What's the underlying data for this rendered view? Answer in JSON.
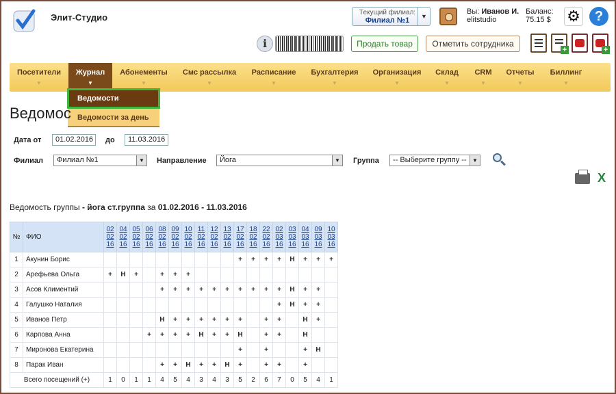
{
  "app": {
    "brand": "Элит-Студио",
    "branch_caption": "Текущий филиал:",
    "branch_value": "Филиал №1",
    "user_prefix": "Вы:",
    "user_name": "Иванов И.",
    "user_login": "elitstudio",
    "balance_caption": "Баланс:",
    "balance_value": "75.15 $"
  },
  "toolbar": {
    "sell_label": "Продать товар",
    "mark_employee_label": "Отметить сотрудника"
  },
  "menu": [
    {
      "label": "Посетители"
    },
    {
      "label": "Журнал"
    },
    {
      "label": "Абонементы"
    },
    {
      "label": "Смс рассылка"
    },
    {
      "label": "Расписание"
    },
    {
      "label": "Бухгалтерия"
    },
    {
      "label": "Организация"
    },
    {
      "label": "Склад"
    },
    {
      "label": "CRM"
    },
    {
      "label": "Отчеты"
    },
    {
      "label": "Биллинг"
    }
  ],
  "dropdown": [
    "Ведомости",
    "Ведомости за день"
  ],
  "page": {
    "title": "Ведомос"
  },
  "filters": {
    "date_from_label": "Дата от",
    "date_from": "01.02.2016",
    "date_to_label": "до",
    "date_to": "11.03.2016",
    "branch_label": "Филиал",
    "branch": "Филиал №1",
    "direction_label": "Направление",
    "direction": "Йога",
    "group_label": "Группа",
    "group": "-- Выберите группу --"
  },
  "report": {
    "prefix": "Ведомость группы",
    "group": " - йога ст.группа",
    "mid": " за ",
    "period": "01.02.2016 - 11.03.2016"
  },
  "table": {
    "col_no": "№",
    "col_fio": "ФИО",
    "dates": [
      [
        "02",
        "02",
        "16"
      ],
      [
        "04",
        "02",
        "16"
      ],
      [
        "05",
        "02",
        "16"
      ],
      [
        "06",
        "02",
        "16"
      ],
      [
        "08",
        "02",
        "16"
      ],
      [
        "09",
        "02",
        "16"
      ],
      [
        "10",
        "02",
        "16"
      ],
      [
        "11",
        "02",
        "16"
      ],
      [
        "12",
        "02",
        "16"
      ],
      [
        "13",
        "02",
        "16"
      ],
      [
        "17",
        "02",
        "16"
      ],
      [
        "18",
        "02",
        "16"
      ],
      [
        "22",
        "02",
        "16"
      ],
      [
        "02",
        "03",
        "16"
      ],
      [
        "03",
        "03",
        "16"
      ],
      [
        "04",
        "03",
        "16"
      ],
      [
        "09",
        "03",
        "16"
      ],
      [
        "10",
        "03",
        "16"
      ]
    ],
    "rows": [
      {
        "no": "1",
        "name": "Акунин Борис",
        "marks": [
          "",
          "",
          "",
          "",
          "",
          "",
          "",
          "",
          "",
          "",
          "+",
          "+",
          "+",
          "+",
          "Н",
          "+",
          "+",
          "+"
        ]
      },
      {
        "no": "2",
        "name": "Арефьева Ольга",
        "marks": [
          "+",
          "Н",
          "+",
          "",
          "+",
          "+",
          "+",
          "",
          "",
          "",
          "",
          "",
          "",
          "",
          "",
          "",
          "",
          ""
        ]
      },
      {
        "no": "3",
        "name": "Асов Климентий",
        "marks": [
          "",
          "",
          "",
          "",
          "+",
          "+",
          "+",
          "+",
          "+",
          "+",
          "+",
          "+",
          "+",
          "+",
          "Н",
          "+",
          "+",
          ""
        ]
      },
      {
        "no": "4",
        "name": "Галушко Наталия",
        "marks": [
          "",
          "",
          "",
          "",
          "",
          "",
          "",
          "",
          "",
          "",
          "",
          "",
          "",
          "+",
          "Н",
          "+",
          "+",
          ""
        ]
      },
      {
        "no": "5",
        "name": "Иванов Петр",
        "marks": [
          "",
          "",
          "",
          "",
          "Н",
          "+",
          "+",
          "+",
          "+",
          "+",
          "+",
          "",
          "+",
          "+",
          "",
          "Н",
          "+",
          ""
        ]
      },
      {
        "no": "6",
        "name": "Карпова Анна",
        "marks": [
          "",
          "",
          "",
          "+",
          "+",
          "+",
          "+",
          "Н",
          "+",
          "+",
          "Н",
          "",
          "+",
          "+",
          "",
          "Н",
          "",
          ""
        ]
      },
      {
        "no": "7",
        "name": "Миронова Екатерина",
        "marks": [
          "",
          "",
          "",
          "",
          "",
          "",
          "",
          "",
          "",
          "",
          "+",
          "",
          "+",
          "",
          "",
          "+",
          "Н",
          ""
        ]
      },
      {
        "no": "8",
        "name": "Парак Иван",
        "marks": [
          "",
          "",
          "",
          "",
          "+",
          "+",
          "Н",
          "+",
          "+",
          "Н",
          "+",
          "",
          "+",
          "+",
          "",
          "+",
          "",
          ""
        ]
      }
    ],
    "total_label": "Всего посещений (+)",
    "totals": [
      "1",
      "0",
      "1",
      "1",
      "4",
      "5",
      "4",
      "3",
      "4",
      "3",
      "5",
      "2",
      "6",
      "7",
      "0",
      "5",
      "4",
      "1"
    ]
  }
}
